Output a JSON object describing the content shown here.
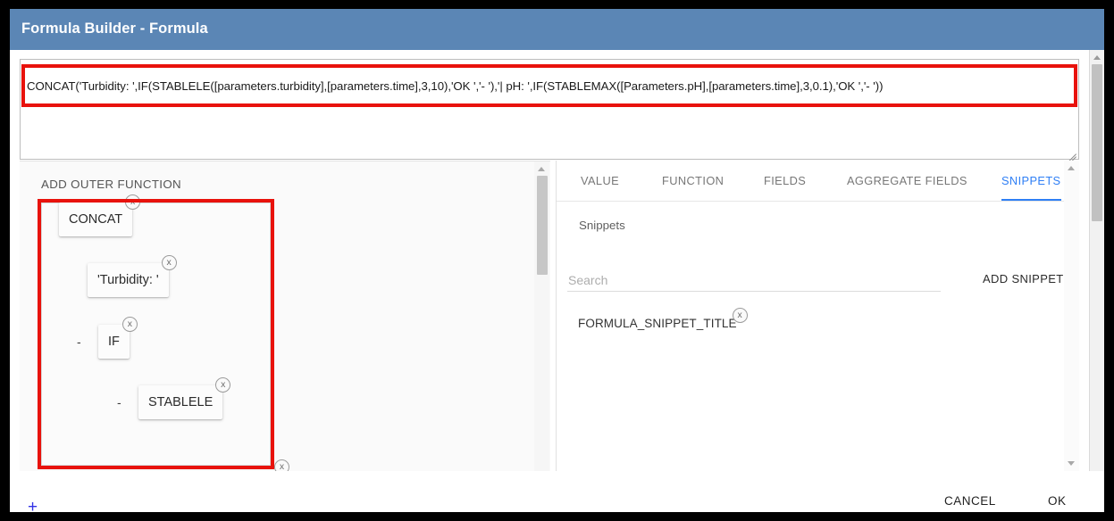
{
  "window": {
    "title": "Formula Builder - Formula"
  },
  "formula": {
    "value": "CONCAT('Turbidity: ',IF(STABLELE([parameters.turbidity],[parameters.time],3,10),'OK ','- '),'| pH: ',IF(STABLEMAX([Parameters.pH],[parameters.time],3,0.1),'OK ','- '))"
  },
  "left_panel": {
    "header": "ADD OUTER FUNCTION",
    "tree": [
      {
        "dash": "-",
        "label": "CONCAT",
        "close": "x",
        "indent": 0,
        "row": 0
      },
      {
        "dash": "",
        "label": "'Turbidity: '",
        "close": "x",
        "indent": 1,
        "row": 1
      },
      {
        "dash": "-",
        "label": "IF",
        "close": "x",
        "indent": 2,
        "row": 2
      },
      {
        "dash": "-",
        "label": "STABLELE",
        "close": "x",
        "indent": 3,
        "row": 3
      }
    ],
    "orphan_close": "x"
  },
  "right_panel": {
    "tabs": [
      {
        "label": "VALUE",
        "active": false
      },
      {
        "label": "FUNCTION",
        "active": false
      },
      {
        "label": "FIELDS",
        "active": false
      },
      {
        "label": "AGGREGATE FIELDS",
        "active": false
      },
      {
        "label": "SNIPPETS",
        "active": true
      }
    ],
    "section_label": "Snippets",
    "search": {
      "value": "",
      "placeholder": "Search"
    },
    "add_snippet_label": "ADD SNIPPET",
    "snippet": {
      "label": "FORMULA_SNIPPET_TITLE",
      "close": "x"
    }
  },
  "footer": {
    "add_label": "+",
    "cancel_label": "CANCEL",
    "ok_label": "OK"
  },
  "colors": {
    "titlebar": "#5b86b5",
    "accent": "#2f7ff5",
    "highlight": "#e8120c",
    "plus": "#3232e6"
  }
}
